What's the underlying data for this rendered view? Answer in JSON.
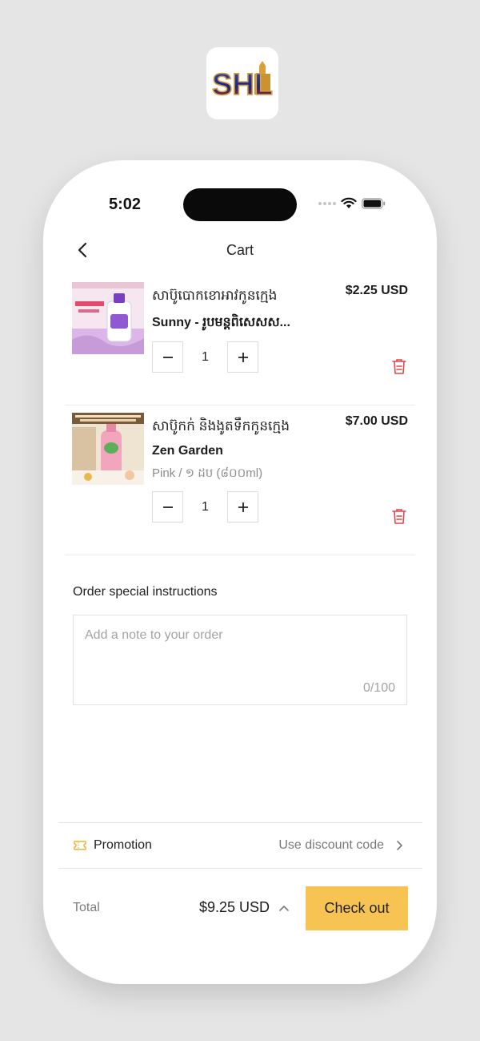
{
  "app": {
    "logo_text": "SHL"
  },
  "status_bar": {
    "time": "5:02"
  },
  "header": {
    "title": "Cart"
  },
  "cart": {
    "items": [
      {
        "title_km": "សាប៊ូបោកខោអាវកូនក្មេង",
        "name": "Sunny - រូបមន្តពិសេសស...",
        "variant": "",
        "price": "$2.25 USD",
        "quantity": "1"
      },
      {
        "title_km": "សាប៊ូកក់ និងងូតទឹកកូនក្មេង",
        "name": "Zen Garden",
        "variant": "Pink / ១ ដប (៨០០ml)",
        "price": "$7.00 USD",
        "quantity": "1"
      }
    ]
  },
  "instructions": {
    "label": "Order special instructions",
    "placeholder": "Add a note to your order",
    "counter": "0/100"
  },
  "promotion": {
    "label": "Promotion",
    "link": "Use discount code"
  },
  "footer": {
    "total_label": "Total",
    "total_amount": "$9.25 USD",
    "checkout_label": "Check out"
  },
  "colors": {
    "accent": "#f7c453",
    "delete": "#e0464a",
    "promo_icon": "#f0b23a",
    "background": "#e5e5e5"
  }
}
